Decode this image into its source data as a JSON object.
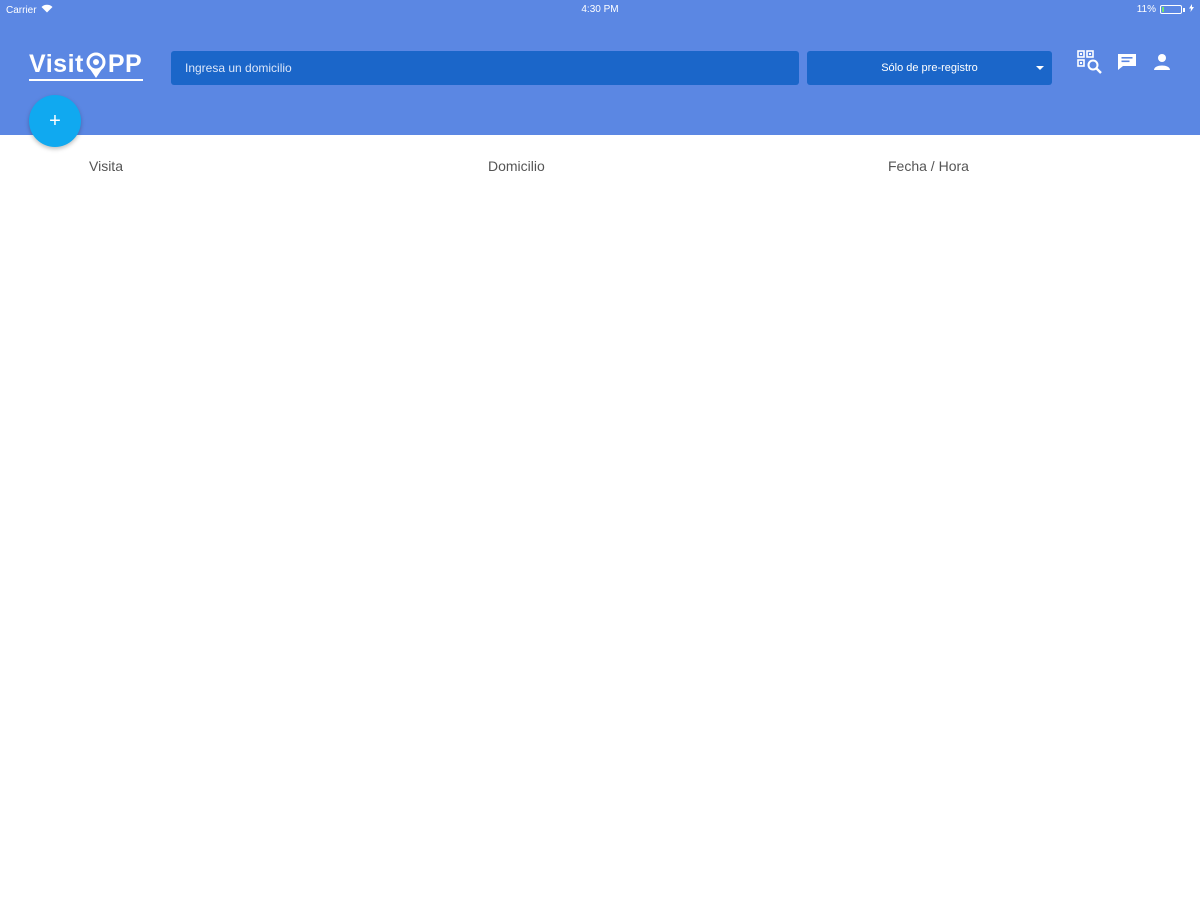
{
  "status_bar": {
    "carrier": "Carrier",
    "time": "4:30 PM",
    "battery": "11%",
    "battery_level": 0.11
  },
  "header": {
    "logo_text_left": "Visit",
    "logo_text_right": "PP",
    "search": {
      "placeholder": "Ingresa un domicilio",
      "value": ""
    },
    "filter": {
      "selected": "Sólo de pre-registro"
    },
    "icons": [
      "qr-search-icon",
      "message-icon",
      "user-icon"
    ],
    "add_label": "+"
  },
  "table": {
    "columns": [
      "Visita",
      "Domicilio",
      "Fecha / Hora"
    ],
    "rows": []
  },
  "colors": {
    "header_bg": "#5b87e3",
    "field_bg": "#1b66c9",
    "fab_bg": "#10a9f0"
  }
}
